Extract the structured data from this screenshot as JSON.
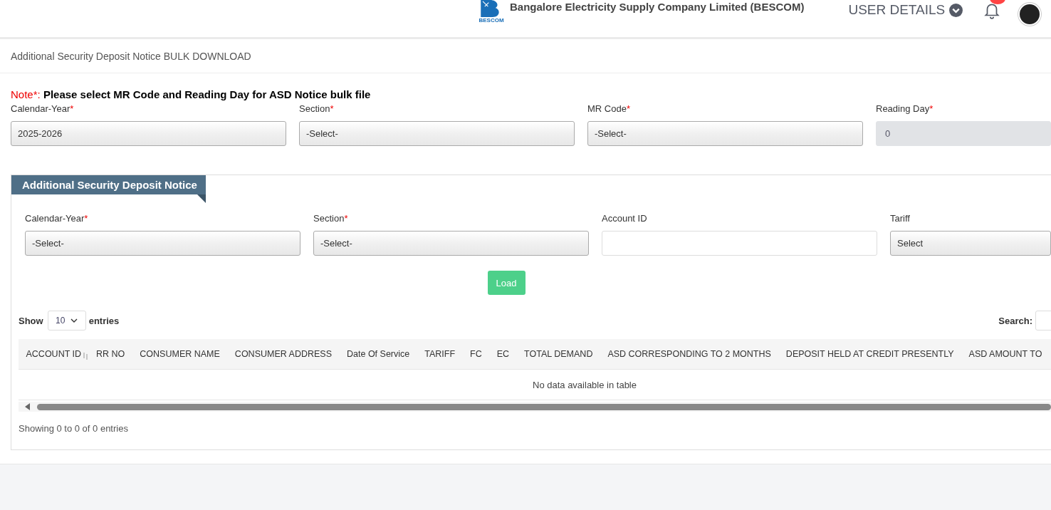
{
  "header": {
    "company": "Bangalore Electricity Supply Company Limited (BESCOM)",
    "logo_text": "BESCOM",
    "user_menu": "USER DETAILS"
  },
  "page_title": "Additional Security Deposit Notice BULK DOWNLOAD",
  "note": {
    "prefix": "Note*:",
    "text": "Please select MR Code and Reading Day for ASD Notice bulk file"
  },
  "bulk_fields": [
    {
      "label": "Calendar-Year",
      "required_mark": "*",
      "kind": "select",
      "value": "2025-2026",
      "disabled": false
    },
    {
      "label": "Section",
      "required_mark": "*",
      "kind": "select",
      "value": "-Select-",
      "disabled": false
    },
    {
      "label": "MR Code",
      "required_mark": "*",
      "kind": "select",
      "value": "-Select-",
      "disabled": false
    },
    {
      "label": "Reading Day",
      "required_mark": "*",
      "kind": "input",
      "value": "0",
      "disabled": true
    }
  ],
  "notice_panel": {
    "title": "Additional Security Deposit Notice",
    "fields": [
      {
        "label": "Calendar-Year",
        "required_mark": "*",
        "kind": "select",
        "value": "-Select-",
        "disabled": false
      },
      {
        "label": "Section",
        "required_mark": "*",
        "kind": "select",
        "value": "-Select-",
        "disabled": false
      },
      {
        "label": "Account ID",
        "kind": "input",
        "disabled": false
      },
      {
        "label": "Tariff",
        "kind": "select",
        "value": "Select",
        "disabled": false
      }
    ],
    "load_button": "Load",
    "table": {
      "show_label": "Show",
      "page_size": "10",
      "entries_label": "entries",
      "search_label": "Search:",
      "columns": [
        "ACCOUNT ID",
        "RR NO",
        "CONSUMER NAME",
        "CONSUMER ADDRESS",
        "Date Of Service",
        "TARIFF",
        "FC",
        "EC",
        "TOTAL DEMAND",
        "ASD CORRESPONDING TO 2 MONTHS",
        "DEPOSIT HELD AT CREDIT PRESENTLY",
        "ASD AMOUNT TO"
      ],
      "empty_message": "No data available in table",
      "info": "Showing 0 to 0 of 0 entries"
    }
  }
}
